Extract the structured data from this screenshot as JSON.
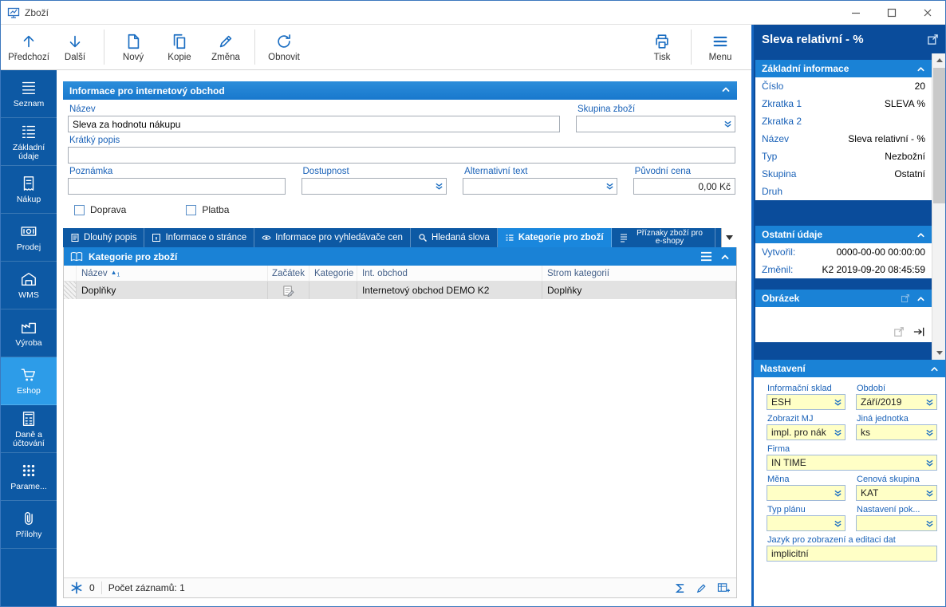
{
  "window": {
    "title": "Zboží"
  },
  "colors": {
    "accent": "#1b82d8",
    "sidebar": "#0d59a4",
    "sidebar_selected": "#2d9ce8",
    "panel_background": "#0a4c9b",
    "field_yellow": "#ffffc6"
  },
  "toolbar": {
    "buttons": [
      {
        "label": "Předchozí",
        "icon": "arrow-up-icon"
      },
      {
        "label": "Další",
        "icon": "arrow-down-icon"
      },
      {
        "label": "Nový",
        "icon": "new-document-icon"
      },
      {
        "label": "Kopie",
        "icon": "copy-icon"
      },
      {
        "label": "Změna",
        "icon": "edit-pencil-icon"
      },
      {
        "label": "Obnovit",
        "icon": "refresh-icon"
      }
    ],
    "right_buttons": [
      {
        "label": "Tisk",
        "icon": "printer-icon"
      },
      {
        "label": "Menu",
        "icon": "hamburger-icon"
      }
    ]
  },
  "sidebar": {
    "items": [
      {
        "label": "Seznam",
        "selected": false
      },
      {
        "label": "Základní údaje",
        "selected": false
      },
      {
        "label": "Nákup",
        "selected": false
      },
      {
        "label": "Prodej",
        "selected": false
      },
      {
        "label": "WMS",
        "selected": false
      },
      {
        "label": "Výroba",
        "selected": false
      },
      {
        "label": "Eshop",
        "selected": true
      },
      {
        "label": "Daně a účtování",
        "selected": false
      },
      {
        "label": "Parame...",
        "selected": false
      },
      {
        "label": "Přílohy",
        "selected": false
      }
    ]
  },
  "main": {
    "section_title": "Informace pro internetový obchod",
    "form": {
      "nazev": {
        "label": "Název",
        "value": "Sleva za hodnotu nákupu"
      },
      "skupina_zbozi": {
        "label": "Skupina zboží",
        "value": ""
      },
      "kratky_popis": {
        "label": "Krátký popis",
        "value": ""
      },
      "poznamka": {
        "label": "Poznámka",
        "value": ""
      },
      "dostupnost": {
        "label": "Dostupnost",
        "value": ""
      },
      "alternativni_text": {
        "label": "Alternativní text",
        "value": ""
      },
      "puvodni_cena": {
        "label": "Původní cena",
        "value": "0,00 Kč"
      },
      "doprava": {
        "label": "Doprava",
        "checked": false
      },
      "platba": {
        "label": "Platba",
        "checked": false
      }
    },
    "tabs": [
      {
        "label": "Dlouhý popis",
        "selected": false
      },
      {
        "label": "Informace o stránce",
        "selected": false
      },
      {
        "label": "Informace pro vyhledávače cen",
        "selected": false
      },
      {
        "label": "Hledaná slova",
        "selected": false
      },
      {
        "label": "Kategorie pro zboží",
        "selected": true
      },
      {
        "label": "Příznaky zboží pro e-shopy",
        "selected": false
      }
    ],
    "table": {
      "title": "Kategorie pro zboží",
      "columns": [
        "Název",
        "Začátek",
        "Kategorie",
        "Int. obchod",
        "Strom kategorií"
      ],
      "sort": {
        "arrow": "▲",
        "order": "1"
      },
      "rows": [
        {
          "nazev": "Doplňky",
          "zacatek": "",
          "kategorie": "",
          "int_obchod": "Internetový obchod DEMO K2",
          "strom_kategorii": "Doplňky"
        }
      ],
      "status": {
        "related_count": "0",
        "records_label": "Počet záznamů: 1"
      }
    }
  },
  "right_panel": {
    "title": "Sleva relativní - %",
    "zakladni_informace": {
      "title": "Základní informace",
      "fields": [
        {
          "label": "Číslo",
          "value": "20"
        },
        {
          "label": "Zkratka 1",
          "value": "SLEVA %"
        },
        {
          "label": "Zkratka 2",
          "value": ""
        },
        {
          "label": "Název",
          "value": "Sleva relativní - %"
        },
        {
          "label": "Typ",
          "value": "Nezbožní"
        },
        {
          "label": "Skupina",
          "value": "Ostatní"
        },
        {
          "label": "Druh",
          "value": ""
        }
      ]
    },
    "ostatni_udaje": {
      "title": "Ostatní údaje",
      "fields": [
        {
          "label": "Vytvořil:",
          "value": "0000-00-00 00:00:00"
        },
        {
          "label": "Změnil:",
          "value": "K2 2019-09-20 08:45:59"
        }
      ]
    },
    "obrazek": {
      "title": "Obrázek"
    },
    "nastaveni": {
      "title": "Nastavení",
      "fields": [
        {
          "label": "Informační sklad",
          "value": "ESH"
        },
        {
          "label": "Období",
          "value": "Září/2019"
        },
        {
          "label": "Zobrazit MJ",
          "value": "impl. pro nák"
        },
        {
          "label": "Jiná jednotka",
          "value": "ks"
        },
        {
          "label": "Firma",
          "value": "IN TIME"
        },
        {
          "label": "Měna",
          "value": ""
        },
        {
          "label": "Cenová skupina",
          "value": "KAT"
        },
        {
          "label": "Typ plánu",
          "value": ""
        },
        {
          "label": "Nastavení pok...",
          "value": ""
        },
        {
          "label": "Jazyk pro zobrazení a editaci dat",
          "value": "implicitní"
        }
      ]
    }
  }
}
